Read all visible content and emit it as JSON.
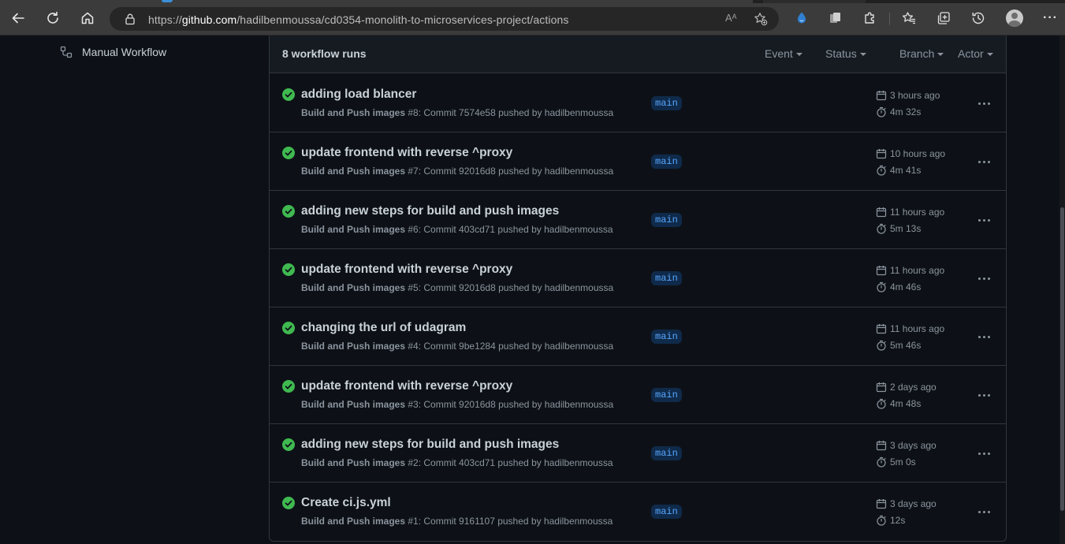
{
  "browser": {
    "url_prefix": "https://",
    "url_domain": "github.com",
    "url_path": "/hadilbenmoussa/cd0354-monolith-to-microservices-project/actions",
    "read_aloud_glyph": "Aᴬ",
    "more_glyph": "···"
  },
  "sidebar": {
    "manual_workflow_label": "Manual Workflow"
  },
  "runs": {
    "count_label": "8 workflow runs",
    "filters": [
      "Event",
      "Status",
      "Branch",
      "Actor"
    ],
    "items": [
      {
        "title": "adding load blancer",
        "workflow": "Build and Push images",
        "detail": " #8: Commit 7574e58 pushed by hadilbenmoussa",
        "branch": "main",
        "when": "3 hours ago",
        "duration": "4m 32s"
      },
      {
        "title": "update frontend with reverse ^proxy",
        "workflow": "Build and Push images",
        "detail": " #7: Commit 92016d8 pushed by hadilbenmoussa",
        "branch": "main",
        "when": "10 hours ago",
        "duration": "4m 41s"
      },
      {
        "title": "adding new steps for build and push images",
        "workflow": "Build and Push images",
        "detail": " #6: Commit 403cd71 pushed by hadilbenmoussa",
        "branch": "main",
        "when": "11 hours ago",
        "duration": "5m 13s"
      },
      {
        "title": "update frontend with reverse ^proxy",
        "workflow": "Build and Push images",
        "detail": " #5: Commit 92016d8 pushed by hadilbenmoussa",
        "branch": "main",
        "when": "11 hours ago",
        "duration": "4m 46s"
      },
      {
        "title": "changing the url of udagram",
        "workflow": "Build and Push images",
        "detail": " #4: Commit 9be1284 pushed by hadilbenmoussa",
        "branch": "main",
        "when": "11 hours ago",
        "duration": "5m 46s"
      },
      {
        "title": "update frontend with reverse ^proxy",
        "workflow": "Build and Push images",
        "detail": " #3: Commit 92016d8 pushed by hadilbenmoussa",
        "branch": "main",
        "when": "2 days ago",
        "duration": "4m 48s"
      },
      {
        "title": "adding new steps for build and push images",
        "workflow": "Build and Push images",
        "detail": " #2: Commit 403cd71 pushed by hadilbenmoussa",
        "branch": "main",
        "when": "3 days ago",
        "duration": "5m 0s"
      },
      {
        "title": "Create ci.js.yml",
        "workflow": "Build and Push images",
        "detail": " #1: Commit 9161107 pushed by hadilbenmoussa",
        "branch": "main",
        "when": "3 days ago",
        "duration": "12s"
      }
    ]
  },
  "colors": {
    "success": "#3fb950",
    "accent": "#58a6ff",
    "background": "#0d1117"
  }
}
